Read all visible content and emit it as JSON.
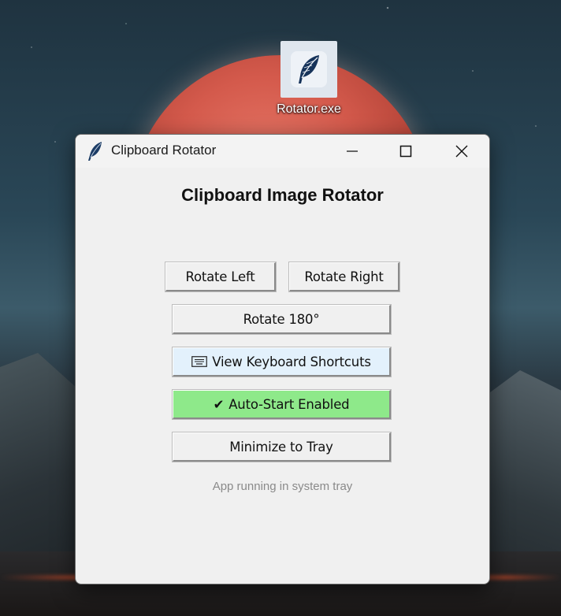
{
  "desktop": {
    "icon_label": "Rotator.exe"
  },
  "window": {
    "title": "Clipboard Rotator",
    "heading": "Clipboard Image Rotator",
    "buttons": {
      "rotate_left": "Rotate Left",
      "rotate_right": "Rotate Right",
      "rotate_180": "Rotate 180°",
      "shortcuts": "View Keyboard Shortcuts",
      "autostart_check": "✔",
      "autostart": "Auto-Start Enabled",
      "tray": "Minimize to Tray"
    },
    "status": "App running in system tray"
  },
  "colors": {
    "window_bg": "#f0f0f0",
    "shortcuts_bg": "#e3f1fc",
    "autostart_bg": "#8ee98a",
    "status_text": "#8a8a8a"
  },
  "icons": {
    "app": "feather-icon",
    "shortcuts": "keyboard-icon",
    "autostart": "checkmark-icon"
  }
}
